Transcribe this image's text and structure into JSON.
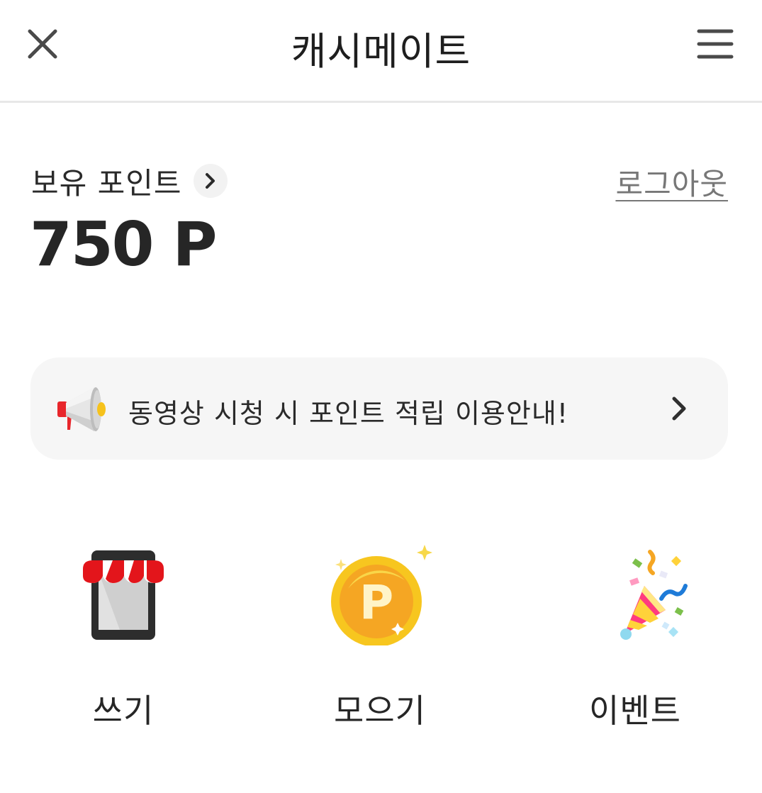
{
  "header": {
    "title": "캐시메이트",
    "close_icon": "close-icon",
    "menu_icon": "hamburger-menu-icon"
  },
  "points": {
    "label": "보유 포인트",
    "value": "750 P",
    "logout_label": "로그아웃"
  },
  "notice": {
    "text": "동영상 시청 시 포인트 적립 이용안내!",
    "icon": "megaphone-icon"
  },
  "menu": {
    "items": [
      {
        "label": "쓰기",
        "icon": "store-icon"
      },
      {
        "label": "모으기",
        "icon": "coin-icon"
      },
      {
        "label": "이벤트",
        "icon": "party-popper-icon"
      }
    ]
  },
  "colors": {
    "text_primary": "#222222",
    "text_secondary": "#777777",
    "divider": "#e8e8e8",
    "notice_bg": "#f6f6f6",
    "accent_red": "#e8262b",
    "coin_gold": "#f5a623"
  }
}
